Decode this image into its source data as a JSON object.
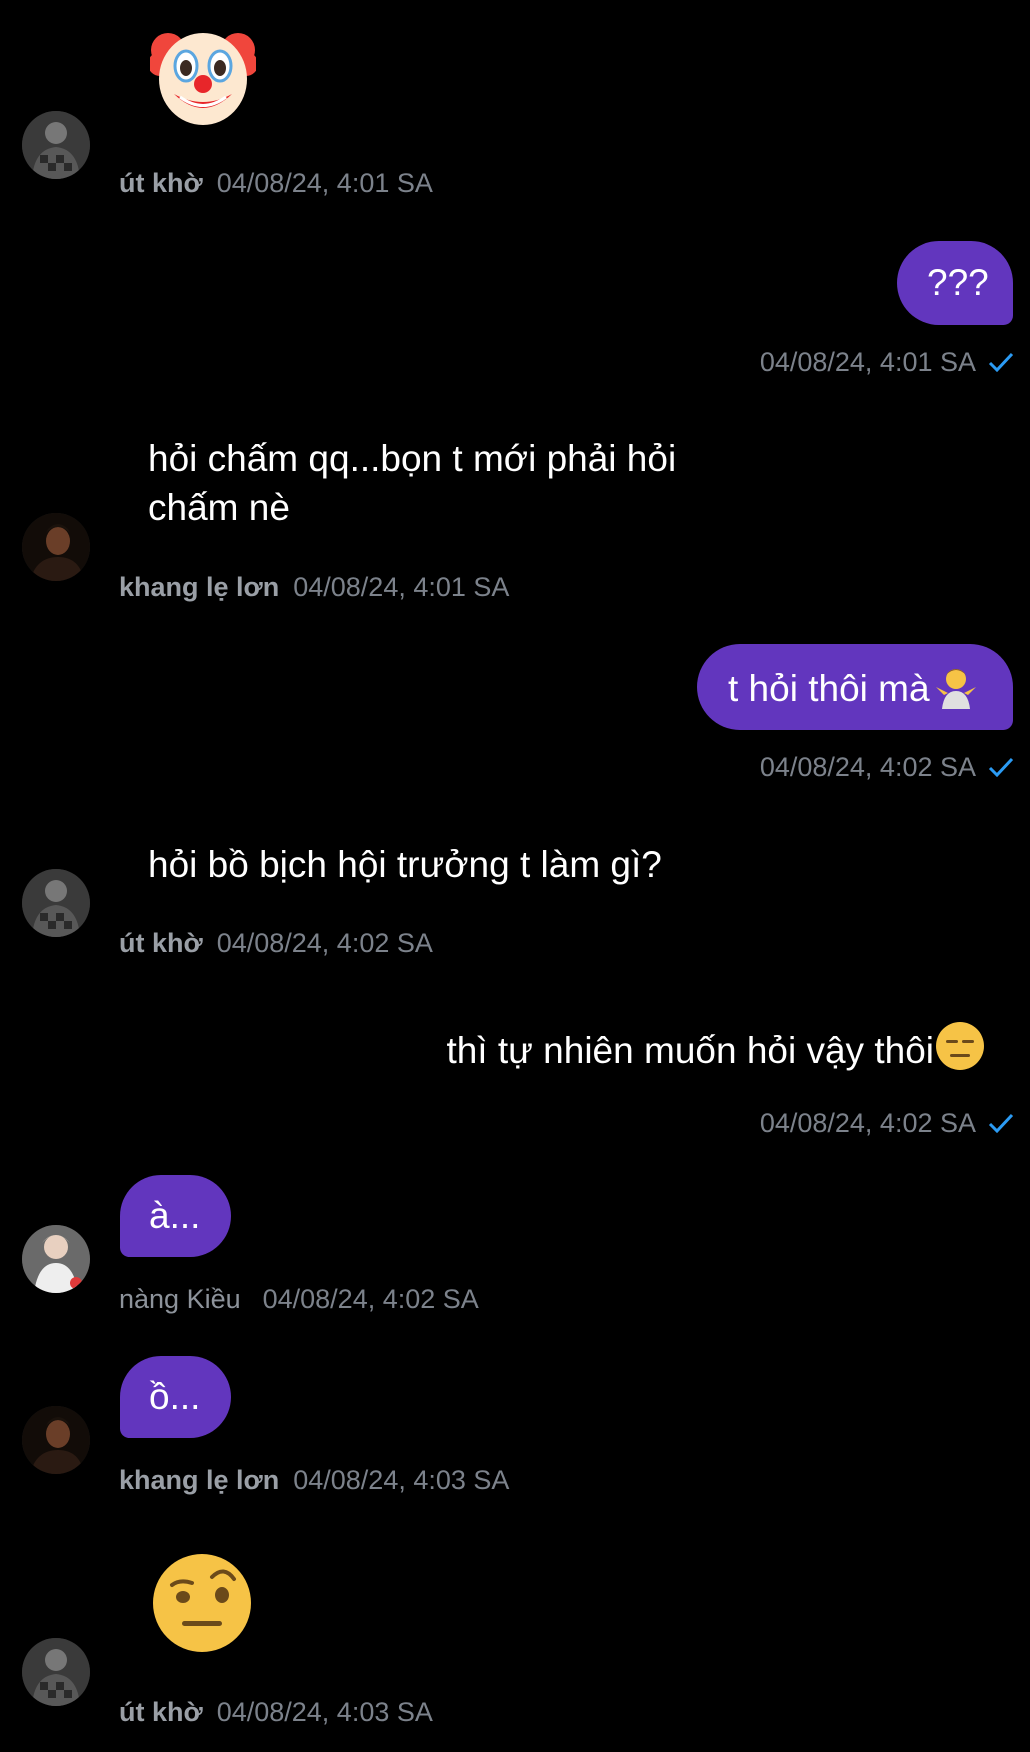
{
  "messages": [
    {
      "sender": "út khờ",
      "time": "04/08/24, 4:01 SA",
      "content_icon": "clown-face-emoji"
    },
    {
      "time": "04/08/24, 4:01 SA",
      "text": "???"
    },
    {
      "sender": "khang lẹ lơn",
      "time": "04/08/24, 4:01 SA",
      "line1": "hỏi chấm qq...bọn t mới phải hỏi",
      "line2": "chấm nè"
    },
    {
      "time": "04/08/24, 4:02 SA",
      "text": "t hỏi thôi mà",
      "emoji_icon": "person-shrugging-emoji"
    },
    {
      "sender": "út khờ",
      "time": "04/08/24, 4:02 SA",
      "text": "hỏi bồ bịch hội trưởng t làm gì?"
    },
    {
      "time": "04/08/24, 4:02 SA",
      "text": "thì tự nhiên muốn hỏi vậy thôi",
      "emoji_icon": "expressionless-face-emoji"
    },
    {
      "sender": "nàng Kiều",
      "time": "04/08/24, 4:02 SA",
      "text": "à..."
    },
    {
      "sender": "khang lẹ lơn",
      "time": "04/08/24, 4:03 SA",
      "text": "ồ..."
    },
    {
      "sender": "út khờ",
      "time": "04/08/24, 4:03 SA",
      "content_icon": "face-with-raised-eyebrow-emoji"
    }
  ],
  "colors": {
    "background": "#000000",
    "bubble": "#6236be",
    "sender_name": "#9a9fa6",
    "timestamp": "#7c828b",
    "read_check": "#2b9bf4"
  }
}
